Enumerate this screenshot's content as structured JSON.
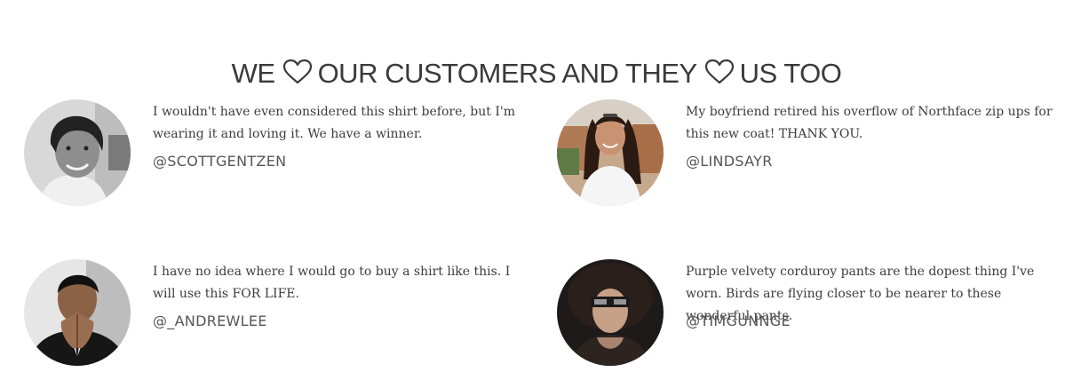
{
  "heading": {
    "part1": "WE",
    "part2": "OUR CUSTOMERS AND THEY",
    "part3": "US TOO",
    "icon": "heart-outline-icon"
  },
  "testimonials": [
    {
      "quote": "I wouldn't have even considered this shirt before, but I'm wearing it and loving it. We have a winner.",
      "handle": "@SCOTTGENTZEN",
      "avatar": "man-smiling-black-and-white-photo"
    },
    {
      "quote": "My boyfriend retired his overflow of Northface zip ups for this new coat! THANK YOU.",
      "handle": "@LINDSAYR",
      "avatar": "woman-white-top-city-background-photo"
    },
    {
      "quote": "I have no idea where I would go to buy a shirt like this. I will use this FOR LIFE.",
      "handle": "@_ANDREWLEE",
      "avatar": "man-in-suit-hands-folded-photo"
    },
    {
      "quote": "Purple velvety corduroy pants are the dopest thing I've worn. Birds are flying closer to be nearer to these wonderful pants.",
      "handle": "@TIMGUNNGE",
      "avatar": "man-curly-hair-sunglasses-photo"
    }
  ],
  "colors": {
    "text": "#3a3a3a",
    "background": "#ffffff"
  }
}
